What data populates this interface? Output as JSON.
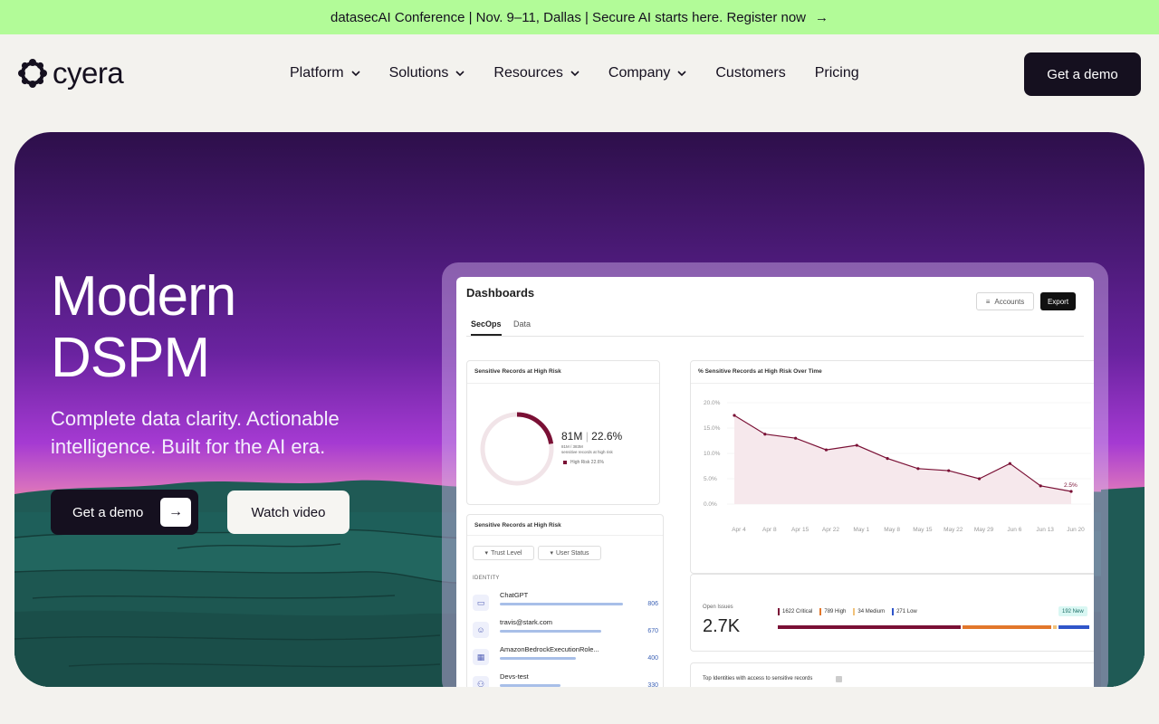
{
  "banner": {
    "text": "datasecAI Conference | Nov. 9–11, Dallas | Secure AI starts here. Register now",
    "arrow": "→"
  },
  "nav": {
    "logo": "cyera",
    "items": [
      {
        "label": "Platform",
        "has_dropdown": true
      },
      {
        "label": "Solutions",
        "has_dropdown": true
      },
      {
        "label": "Resources",
        "has_dropdown": true
      },
      {
        "label": "Company",
        "has_dropdown": true
      },
      {
        "label": "Customers",
        "has_dropdown": false
      },
      {
        "label": "Pricing",
        "has_dropdown": false
      }
    ],
    "cta": "Get a demo"
  },
  "hero": {
    "title_line1": "Modern",
    "title_line2": "DSPM",
    "subtitle": "Complete data clarity. Actionable intelligence. Built for the AI era.",
    "primary_cta": "Get a demo",
    "secondary_cta": "Watch video"
  },
  "dashboard": {
    "title": "Dashboards",
    "accounts": "Accounts",
    "export": "Export",
    "tabs": [
      "SecOps",
      "Data"
    ],
    "donut": {
      "title": "Sensitive Records at High Risk",
      "value": "81M",
      "percent": "22.6%",
      "sub1": "81M / 383M",
      "sub2": "sensitive records at high risk",
      "legend": "High Risk 22.6%",
      "fraction": 0.226
    },
    "line": {
      "title": "% Sensitive Records at High Risk Over Time",
      "yticks": [
        "20.0%",
        "15.0%",
        "10.0%",
        "5.0%",
        "0.0%"
      ],
      "end_label": "2.5%"
    },
    "identities": {
      "title": "Sensitive Records at High Risk",
      "filters": [
        "Trust Level",
        "User Status"
      ],
      "section": "IDENTITY",
      "rows": [
        {
          "name": "ChatGPT",
          "value": "806",
          "icon": "window-icon",
          "share": 0.92
        },
        {
          "name": "travis@stark.com",
          "value": "670",
          "icon": "user-icon",
          "share": 0.76
        },
        {
          "name": "AmazonBedrockExecutionRole...",
          "value": "400",
          "icon": "chip-icon",
          "share": 0.57
        },
        {
          "name": "Devs-test",
          "value": "330",
          "icon": "group-icon",
          "share": 0.45
        }
      ]
    },
    "issues": {
      "label": "Open Issues",
      "value": "2.7K",
      "legend": [
        {
          "label": "1622 Critical",
          "color": "#7a1035",
          "count": 1622
        },
        {
          "label": "789 High",
          "color": "#e2772b",
          "count": 789
        },
        {
          "label": "34 Medium",
          "color": "#f1c27a",
          "count": 34
        },
        {
          "label": "271 Low",
          "color": "#2f55c9",
          "count": 271
        }
      ],
      "new_badge": "192 New"
    },
    "top_identities": {
      "title": "Top Identities with access to sensitive records"
    }
  },
  "chart_data": {
    "type": "line",
    "title": "% Sensitive Records at High Risk Over Time",
    "x": [
      "Apr 4",
      "Apr 8",
      "Apr 15",
      "Apr 22",
      "May 1",
      "May 8",
      "May 15",
      "May 22",
      "May 29",
      "Jun 6",
      "Jun 13",
      "Jun 20"
    ],
    "series": [
      {
        "name": "",
        "values": [
          17.5,
          13.8,
          13.0,
          10.7,
          11.6,
          9.0,
          7.0,
          6.6,
          5.0,
          8.0,
          3.6,
          2.5
        ],
        "color": "#7a1035"
      }
    ],
    "ylim": [
      0,
      20
    ],
    "yticks": [
      "20.0%",
      "15.0%",
      "10.0%",
      "5.0%",
      "0.0%"
    ],
    "annotations": [
      "2.5%"
    ],
    "grid": true
  },
  "colors": {
    "banner": "#b2fb98",
    "dark": "#15101f",
    "accent": "#7a1035"
  }
}
